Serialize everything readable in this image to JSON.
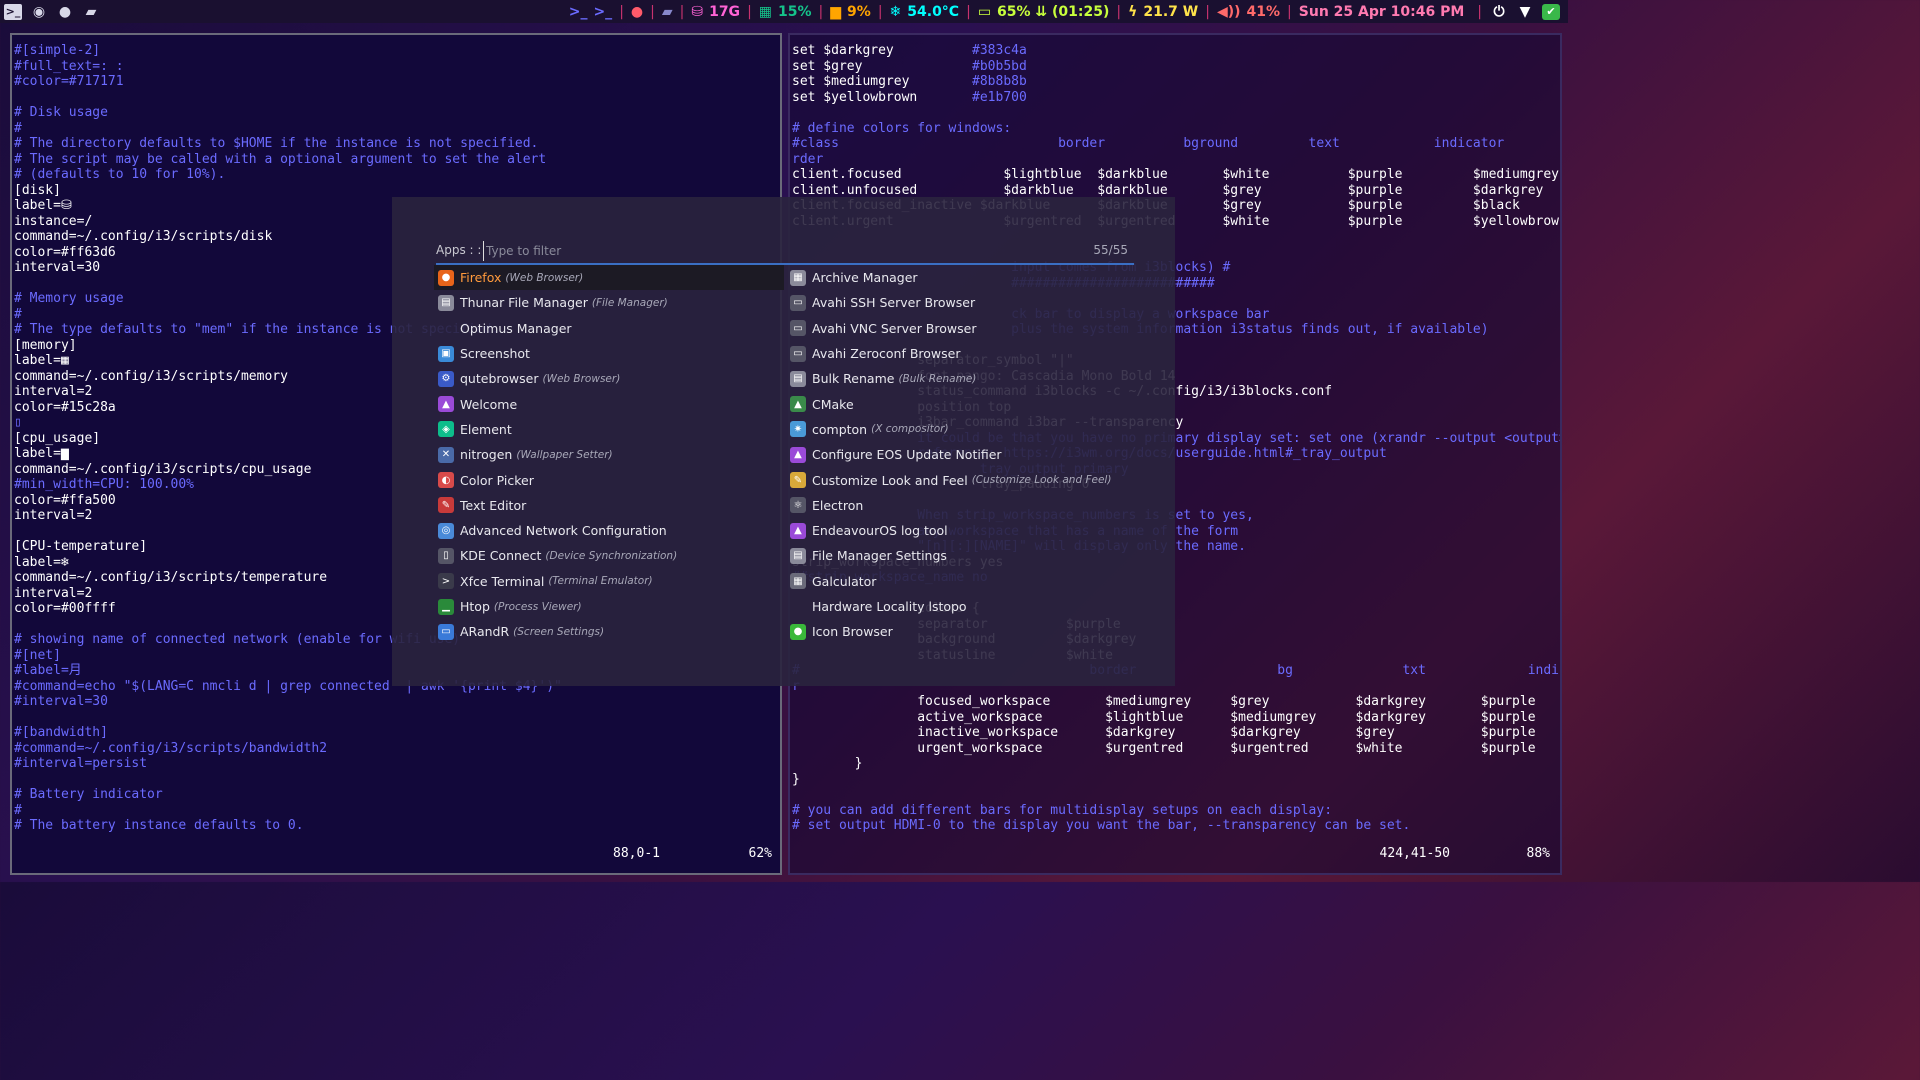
{
  "topbar": {
    "left_icons": [
      "terminal-icon",
      "record-icon",
      "chat-icon",
      "folder-icon"
    ],
    "blocks": [
      {
        "name": "terminal",
        "icon": "terminal-prompt-icon",
        "text": ">_",
        "color": "#6b6bff"
      },
      {
        "name": "recording",
        "icon": "record-dot-icon",
        "text": "",
        "color": "#ff5a6a"
      },
      {
        "name": "folder",
        "icon": "folder-icon",
        "text": "",
        "color": "#8888cc"
      },
      {
        "name": "disk",
        "icon": "disk-icon",
        "text": "17G",
        "color": "#ff63d6"
      },
      {
        "name": "memory",
        "icon": "memory-icon",
        "text": "15%",
        "color": "#15c28a"
      },
      {
        "name": "cpu",
        "icon": "cpu-icon",
        "text": "9%",
        "color": "#ffa500"
      },
      {
        "name": "temperature",
        "icon": "snowflake-icon",
        "text": "54.0°C",
        "color": "#00ffff"
      },
      {
        "name": "battery",
        "icon": "battery-icon",
        "text": "65% ⇊ (01:25)",
        "color": "#c8ff3c"
      },
      {
        "name": "power",
        "icon": "bolt-icon",
        "text": "21.7 W",
        "color": "#ffe24a"
      },
      {
        "name": "volume",
        "icon": "speaker-icon",
        "text": "41%",
        "color": "#ff6a6a"
      },
      {
        "name": "date",
        "icon": "",
        "text": "Sun 25 Apr 10:46 PM",
        "color": "#ff7ab0"
      }
    ],
    "right_icons": [
      "power-icon",
      "wifi-icon",
      "shield-icon"
    ]
  },
  "term_left": {
    "lines": [
      {
        "t": "#[simple-2]",
        "k": "c"
      },
      {
        "t": "#full_text=: :",
        "k": "c"
      },
      {
        "t": "#color=#717171",
        "k": "c"
      },
      {
        "t": "",
        "k": "w"
      },
      {
        "t": "# Disk usage",
        "k": "c"
      },
      {
        "t": "#",
        "k": "c"
      },
      {
        "t": "# The directory defaults to $HOME if the instance is not specified.",
        "k": "c"
      },
      {
        "t": "# The script may be called with a optional argument to set the alert",
        "k": "c"
      },
      {
        "t": "# (defaults to 10 for 10%).",
        "k": "c"
      },
      {
        "t": "[disk]",
        "k": "w"
      },
      {
        "t": "label=⛁",
        "k": "w"
      },
      {
        "t": "instance=/",
        "k": "w"
      },
      {
        "t": "command=~/.config/i3/scripts/disk",
        "k": "w"
      },
      {
        "t": "color=#ff63d6",
        "k": "w"
      },
      {
        "t": "interval=30",
        "k": "w"
      },
      {
        "t": "",
        "k": "w"
      },
      {
        "t": "# Memory usage",
        "k": "c"
      },
      {
        "t": "#",
        "k": "c"
      },
      {
        "t": "# The type defaults to \"mem\" if the instance is not specified.",
        "k": "c"
      },
      {
        "t": "[memory]",
        "k": "w"
      },
      {
        "t": "label=▦",
        "k": "w"
      },
      {
        "t": "command=~/.config/i3/scripts/memory",
        "k": "w"
      },
      {
        "t": "interval=2",
        "k": "w"
      },
      {
        "t": "color=#15c28a",
        "k": "w"
      },
      {
        "t": "▯",
        "k": "c"
      },
      {
        "t": "[cpu_usage]",
        "k": "w"
      },
      {
        "t": "label=▆",
        "k": "w"
      },
      {
        "t": "command=~/.config/i3/scripts/cpu_usage",
        "k": "w"
      },
      {
        "t": "#min_width=CPU: 100.00%",
        "k": "c"
      },
      {
        "t": "color=#ffa500",
        "k": "w"
      },
      {
        "t": "interval=2",
        "k": "w"
      },
      {
        "t": "",
        "k": "w"
      },
      {
        "t": "[CPU-temperature]",
        "k": "w"
      },
      {
        "t": "label=❄",
        "k": "w"
      },
      {
        "t": "command=~/.config/i3/scripts/temperature",
        "k": "w"
      },
      {
        "t": "interval=2",
        "k": "w"
      },
      {
        "t": "color=#00ffff",
        "k": "w"
      },
      {
        "t": "",
        "k": "w"
      },
      {
        "t": "# showing name of connected network (enable for wifi use)",
        "k": "c"
      },
      {
        "t": "#[net]",
        "k": "c"
      },
      {
        "t": "#label=⽉",
        "k": "c"
      },
      {
        "t": "#command=echo \"$(LANG=C nmcli d | grep connected  | awk '{print $4}')\"",
        "k": "c"
      },
      {
        "t": "#interval=30",
        "k": "c"
      },
      {
        "t": "",
        "k": "w"
      },
      {
        "t": "#[bandwidth]",
        "k": "c"
      },
      {
        "t": "#command=~/.config/i3/scripts/bandwidth2",
        "k": "c"
      },
      {
        "t": "#interval=persist",
        "k": "c"
      },
      {
        "t": "",
        "k": "w"
      },
      {
        "t": "# Battery indicator",
        "k": "c"
      },
      {
        "t": "#",
        "k": "c"
      },
      {
        "t": "# The battery instance defaults to 0.",
        "k": "c"
      }
    ],
    "status_pos": "88,0-1",
    "status_pct": "62%"
  },
  "term_right": {
    "lines": [
      {
        "t": "set $darkgrey          #383c4a",
        "k": "w",
        "h": "#383c4a"
      },
      {
        "t": "set $grey              #b0b5bd",
        "k": "w",
        "h": "#b0b5bd"
      },
      {
        "t": "set $mediumgrey        #8b8b8b",
        "k": "w",
        "h": "#8b8b8b"
      },
      {
        "t": "set $yellowbrown       #e1b700",
        "k": "w",
        "h": "#e1b700"
      },
      {
        "t": "",
        "k": "w"
      },
      {
        "t": "# define colors for windows:",
        "k": "c"
      },
      {
        "t": "#class                            border          bground         text            indicator       child_bo",
        "k": "c"
      },
      {
        "t": "rder",
        "k": "c"
      },
      {
        "t": "client.focused             $lightblue  $darkblue       $white          $purple         $mediumgrey",
        "k": "w"
      },
      {
        "t": "client.unfocused           $darkblue   $darkblue       $grey           $purple         $darkgrey",
        "k": "w"
      },
      {
        "t": "client.focused_inactive $darkblue      $darkblue       $grey           $purple         $black",
        "k": "w"
      },
      {
        "t": "client.urgent              $urgentred  $urgentred      $white          $purple         $yellowbrown",
        "k": "w"
      },
      {
        "t": "",
        "k": "w"
      },
      {
        "t": "",
        "k": "w"
      },
      {
        "t": "                            input comes from i3blocks) #",
        "k": "c"
      },
      {
        "t": "                            ##########################",
        "k": "c"
      },
      {
        "t": "",
        "k": "w"
      },
      {
        "t": "                            ck bar to display a workspace bar",
        "k": "c"
      },
      {
        "t": "                            plus the system information i3status finds out, if available)",
        "k": "c"
      },
      {
        "t": "",
        "k": "w"
      },
      {
        "t": "                separator_symbol \"|\"",
        "k": "w"
      },
      {
        "t": "                font pango: Cascadia Mono Bold 14",
        "k": "w"
      },
      {
        "t": "                status_command i3blocks -c ~/.config/i3/i3blocks.conf",
        "k": "w"
      },
      {
        "t": "                position top",
        "k": "w"
      },
      {
        "t": "                i3bar_command i3bar --transparency",
        "k": "w"
      },
      {
        "t": "                it could be that you have no primary display set: set one (xrandr --output <output> --primary)",
        "k": "c"
      },
      {
        "t": "                reference: https://i3wm.org/docs/userguide.html#_tray_output",
        "k": "c"
      },
      {
        "t": "                        tray_output primary",
        "k": "c"
      },
      {
        "t": "                        tray_padding 0",
        "k": "w"
      },
      {
        "t": "",
        "k": "w"
      },
      {
        "t": "                When strip_workspace_numbers is set to yes,",
        "k": "c"
      },
      {
        "t": "                any workspace that has a name of the form",
        "k": "c"
      },
      {
        "t": "                \"[n][:][NAME]\" will display only the name.",
        "k": "c"
      },
      {
        "t": "strip_workspace_numbers yes",
        "k": "w"
      },
      {
        "t": "##strip_workspace_name no",
        "k": "c"
      },
      {
        "t": "",
        "k": "w"
      },
      {
        "t": "                colors {",
        "k": "w"
      },
      {
        "t": "                separator          $purple",
        "k": "w"
      },
      {
        "t": "                background         $darkgrey",
        "k": "w"
      },
      {
        "t": "                statusline         $white",
        "k": "w"
      },
      {
        "t": "#                                     border                  bg              txt             indicato",
        "k": "c"
      },
      {
        "t": "r",
        "k": "c"
      },
      {
        "t": "                focused_workspace       $mediumgrey     $grey           $darkgrey       $purple",
        "k": "w"
      },
      {
        "t": "                active_workspace        $lightblue      $mediumgrey     $darkgrey       $purple",
        "k": "w"
      },
      {
        "t": "                inactive_workspace      $darkgrey       $darkgrey       $grey           $purple",
        "k": "w"
      },
      {
        "t": "                urgent_workspace        $urgentred      $urgentred      $white          $purple",
        "k": "w"
      },
      {
        "t": "        }",
        "k": "w"
      },
      {
        "t": "}",
        "k": "w"
      },
      {
        "t": "",
        "k": "w"
      },
      {
        "t": "# you can add different bars for multidisplay setups on each display:",
        "k": "c"
      },
      {
        "t": "# set output HDMI-0 to the display you want the bar, --transparency can be set.",
        "k": "c"
      }
    ],
    "status_pos": "424,41-50",
    "status_pct": "88%"
  },
  "launcher": {
    "prompt": "Apps : :",
    "placeholder": "Type to filter",
    "count": "55/55",
    "left_apps": [
      {
        "name": "Firefox",
        "desc": "(Web Browser)",
        "icon": "firefox-icon",
        "color": "#e8641a",
        "glyph": "●",
        "selected": true
      },
      {
        "name": "Thunar File Manager",
        "desc": "(File Manager)",
        "icon": "file-manager-icon",
        "color": "#8a8a9a",
        "glyph": "▤"
      },
      {
        "name": "Optimus Manager",
        "desc": "",
        "icon": "",
        "color": "",
        "glyph": ""
      },
      {
        "name": "Screenshot",
        "desc": "",
        "icon": "screenshot-icon",
        "color": "#3a8ad8",
        "glyph": "▣"
      },
      {
        "name": "qutebrowser",
        "desc": "(Web Browser)",
        "icon": "qutebrowser-icon",
        "color": "#3a5ac8",
        "glyph": "⚙"
      },
      {
        "name": "Welcome",
        "desc": "",
        "icon": "endeavouros-icon",
        "color": "#9a4ad8",
        "glyph": "▲"
      },
      {
        "name": "Element",
        "desc": "",
        "icon": "element-icon",
        "color": "#0dbd8b",
        "glyph": "◈"
      },
      {
        "name": "nitrogen",
        "desc": "(Wallpaper Setter)",
        "icon": "nitrogen-icon",
        "color": "#4a6aa8",
        "glyph": "✕"
      },
      {
        "name": "Color Picker",
        "desc": "",
        "icon": "color-picker-icon",
        "color": "#d84a4a",
        "glyph": "◐"
      },
      {
        "name": "Text Editor",
        "desc": "",
        "icon": "text-editor-icon",
        "color": "#c83a3a",
        "glyph": "✎"
      },
      {
        "name": "Advanced Network Configuration",
        "desc": "",
        "icon": "network-icon",
        "color": "#4a8ad8",
        "glyph": "◎"
      },
      {
        "name": "KDE Connect",
        "desc": "(Device Synchronization)",
        "icon": "kde-connect-icon",
        "color": "#555566",
        "glyph": "▯"
      },
      {
        "name": "Xfce Terminal",
        "desc": "(Terminal Emulator)",
        "icon": "terminal-icon",
        "color": "#3a3a4a",
        "glyph": ">"
      },
      {
        "name": "Htop",
        "desc": "(Process Viewer)",
        "icon": "htop-icon",
        "color": "#2a8a3a",
        "glyph": "▁"
      },
      {
        "name": "ARandR",
        "desc": "(Screen Settings)",
        "icon": "arandr-icon",
        "color": "#3a7ad8",
        "glyph": "▭"
      }
    ],
    "right_apps": [
      {
        "name": "Archive Manager",
        "desc": "",
        "icon": "archive-icon",
        "color": "#8a8a9a",
        "glyph": "▦"
      },
      {
        "name": "Avahi SSH Server Browser",
        "desc": "",
        "icon": "avahi-ssh-icon",
        "color": "#555566",
        "glyph": "▭"
      },
      {
        "name": "Avahi VNC Server Browser",
        "desc": "",
        "icon": "avahi-vnc-icon",
        "color": "#555566",
        "glyph": "▭"
      },
      {
        "name": "Avahi Zeroconf Browser",
        "desc": "",
        "icon": "avahi-zeroconf-icon",
        "color": "#555566",
        "glyph": "▭"
      },
      {
        "name": "Bulk Rename",
        "desc": "(Bulk Rename)",
        "icon": "bulk-rename-icon",
        "color": "#8a8a9a",
        "glyph": "▤"
      },
      {
        "name": "CMake",
        "desc": "",
        "icon": "cmake-icon",
        "color": "#3a8a4a",
        "glyph": "▲"
      },
      {
        "name": "compton",
        "desc": "(X compositor)",
        "icon": "compton-icon",
        "color": "#4a9ad8",
        "glyph": "✷"
      },
      {
        "name": "Configure EOS Update Notifier",
        "desc": "",
        "icon": "eos-update-icon",
        "color": "#9a4ad8",
        "glyph": "▲"
      },
      {
        "name": "Customize Look and Feel",
        "desc": "(Customize Look and Feel)",
        "icon": "customize-look-icon",
        "color": "#d8a83a",
        "glyph": "✎"
      },
      {
        "name": "Electron",
        "desc": "",
        "icon": "electron-icon",
        "color": "#555566",
        "glyph": "⚛"
      },
      {
        "name": "EndeavourOS log tool",
        "desc": "",
        "icon": "eos-log-icon",
        "color": "#9a4ad8",
        "glyph": "▲"
      },
      {
        "name": "File Manager Settings",
        "desc": "",
        "icon": "file-manager-settings-icon",
        "color": "#8a8a9a",
        "glyph": "▤"
      },
      {
        "name": "Galculator",
        "desc": "",
        "icon": "calculator-icon",
        "color": "#6a6a7a",
        "glyph": "▦"
      },
      {
        "name": "Hardware Locality lstopo",
        "desc": "",
        "icon": "",
        "color": "",
        "glyph": ""
      },
      {
        "name": "Icon Browser",
        "desc": "",
        "icon": "icon-browser-icon",
        "color": "#3ab83a",
        "glyph": "●"
      }
    ]
  }
}
